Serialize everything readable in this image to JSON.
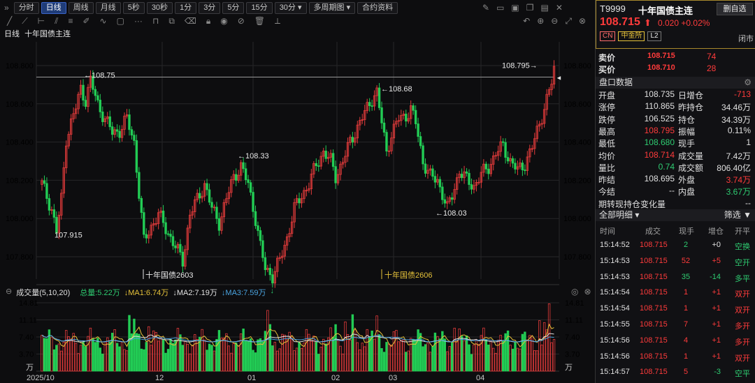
{
  "toolbar": {
    "expand_icon": "»",
    "periods": [
      "分时",
      "日线",
      "周线",
      "月线",
      "5秒",
      "30秒",
      "1分",
      "3分",
      "5分",
      "15分",
      "30分 ▾",
      "多周期图 ▾",
      "合约资料"
    ],
    "active_index": 1
  },
  "chart": {
    "title_period": "日线",
    "title_symbol": "十年国债主连",
    "y_ticks": [
      "108.800",
      "108.600",
      "108.400",
      "108.200",
      "108.000",
      "107.800"
    ],
    "y_tick_values": [
      108.8,
      108.6,
      108.4,
      108.2,
      108.0,
      107.8
    ],
    "annotations": [
      "←108.75",
      "107.915",
      "←108.33",
      "←108.68",
      "←108.03",
      "108.795→"
    ],
    "contract_labels": [
      "十年国债2603",
      "十年国债2606"
    ],
    "x_labels": [
      "2025/10",
      "12",
      "01",
      "02",
      "03",
      "04"
    ],
    "last_close_marker": "◄",
    "colors": {
      "up": "#e33b3b",
      "down": "#22cc55",
      "ma1": "#e6c23a",
      "ma2": "#e0e0e0",
      "ma3": "#4aa3df"
    }
  },
  "volume": {
    "title": "成交量(5,10,20)",
    "total": "总量:5.22万",
    "ma1": "MA1:6.74万",
    "ma2": "MA2:7.19万",
    "ma3": "MA3:7.59万",
    "y_ticks": [
      "14.81",
      "11.11",
      "7.40",
      "3.70",
      "万"
    ],
    "y_tick_values": [
      14.81,
      11.11,
      7.4,
      3.7
    ]
  },
  "panel": {
    "code": "T9999",
    "name": "十年国债主连",
    "add_button": "删自选",
    "price": "108.715",
    "change": "0.020",
    "change_pct": "+0.02%",
    "tags": [
      "CN",
      "中金所",
      "L2"
    ],
    "status": "闭市",
    "ask_label": "卖价",
    "ask_price": "108.715",
    "ask_qty": "74",
    "bid_label": "买价",
    "bid_price": "108.710",
    "bid_qty": "28",
    "section_quote": "盘口数据",
    "quote_rows": [
      [
        "开盘",
        "108.735",
        "日增仓",
        "-713"
      ],
      [
        "涨停",
        "110.865",
        "昨持仓",
        "34.46万"
      ],
      [
        "跌停",
        "106.525",
        "持仓",
        "34.39万"
      ],
      [
        "最高",
        "108.795",
        "振幅",
        "0.11%"
      ],
      [
        "最低",
        "108.680",
        "现手",
        "1"
      ],
      [
        "均价",
        "108.714",
        "成交量",
        "7.42万"
      ],
      [
        "量比",
        "0.74",
        "成交额",
        "806.40亿"
      ],
      [
        "昨结",
        "108.695",
        "外盘",
        "3.74万"
      ],
      [
        "今结",
        "--",
        "内盘",
        "3.67万"
      ]
    ],
    "pos_change_label": "期转现持仓变化量",
    "pos_change_value": "--",
    "section_detail": "全部明细 ▾",
    "filter_label": "筛选",
    "trade_headers": [
      "时间",
      "成交",
      "现手",
      "增仓",
      "开平"
    ],
    "trades": [
      [
        "15:14:52",
        "108.715",
        "2",
        "+0",
        "空换"
      ],
      [
        "15:14:53",
        "108.715",
        "52",
        "+5",
        "空开"
      ],
      [
        "15:14:53",
        "108.715",
        "35",
        "-14",
        "多平"
      ],
      [
        "15:14:54",
        "108.715",
        "1",
        "+1",
        "双开"
      ],
      [
        "15:14:54",
        "108.715",
        "1",
        "+1",
        "双开"
      ],
      [
        "15:14:55",
        "108.715",
        "7",
        "+1",
        "多开"
      ],
      [
        "15:14:56",
        "108.715",
        "4",
        "+1",
        "多开"
      ],
      [
        "15:14:56",
        "108.715",
        "1",
        "+1",
        "双开"
      ],
      [
        "15:14:57",
        "108.715",
        "5",
        "-3",
        "空平"
      ]
    ]
  }
}
